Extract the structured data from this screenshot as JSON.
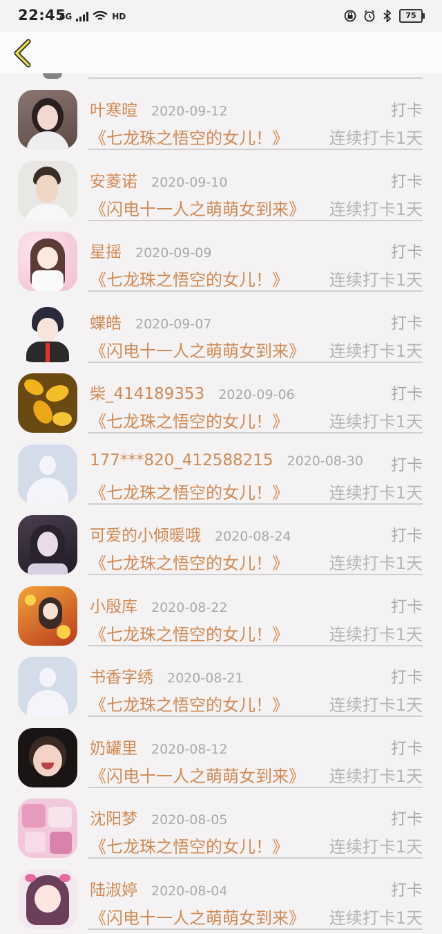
{
  "status_bar": {
    "time": "22:45",
    "network": "4G",
    "hd": "HD",
    "battery": "75"
  },
  "header": {
    "back_icon": "chevron-left-icon"
  },
  "colors": {
    "accent": "#d08a55",
    "muted": "#a9a9a9",
    "divider": "#cfcfcf"
  },
  "items": [
    {
      "name": "叶寒暄",
      "date": "2020-09-12",
      "tag": "打卡",
      "book": "《七龙珠之悟空的女儿！》",
      "streak": "连续打卡1天",
      "avatar": "avatar-girl-photo"
    },
    {
      "name": "安菱诺",
      "date": "2020-09-10",
      "tag": "打卡",
      "book": "《闪电十一人之萌萌女到来》",
      "streak": "连续打卡1天",
      "avatar": "avatar-boy-photo"
    },
    {
      "name": "星摇",
      "date": "2020-09-09",
      "tag": "打卡",
      "book": "《七龙珠之悟空的女儿！》",
      "streak": "连续打卡1天",
      "avatar": "avatar-anime-girl"
    },
    {
      "name": "蝶皓",
      "date": "2020-09-07",
      "tag": "打卡",
      "book": "《闪电十一人之萌萌女到来》",
      "streak": "连续打卡1天",
      "avatar": "avatar-anime-boy"
    },
    {
      "name": "柴_414189353",
      "date": "2020-09-06",
      "tag": "打卡",
      "book": "《七龙珠之悟空的女儿！》",
      "streak": "连续打卡1天",
      "avatar": "avatar-yellow-flowers"
    },
    {
      "name": "177***820_412588215",
      "date": "2020-08-30",
      "tag": "打卡",
      "book": "《七龙珠之悟空的女儿！》",
      "streak": "连续打卡1天",
      "avatar": "avatar-placeholder"
    },
    {
      "name": "可爱的小倾暖哦",
      "date": "2020-08-24",
      "tag": "打卡",
      "book": "《七龙珠之悟空的女儿！》",
      "streak": "连续打卡1天",
      "avatar": "avatar-girl-dark"
    },
    {
      "name": "小殷库",
      "date": "2020-08-22",
      "tag": "打卡",
      "book": "《七龙珠之悟空的女儿！》",
      "streak": "连续打卡1天",
      "avatar": "avatar-anime-autumn"
    },
    {
      "name": "书香字绣",
      "date": "2020-08-21",
      "tag": "打卡",
      "book": "《七龙珠之悟空的女儿！》",
      "streak": "连续打卡1天",
      "avatar": "avatar-placeholder"
    },
    {
      "name": "奶罐里",
      "date": "2020-08-12",
      "tag": "打卡",
      "book": "《闪电十一人之萌萌女到来》",
      "streak": "连续打卡1天",
      "avatar": "avatar-child-photo"
    },
    {
      "name": "沈阳梦",
      "date": "2020-08-05",
      "tag": "打卡",
      "book": "《七龙珠之悟空的女儿！》",
      "streak": "连续打卡1天",
      "avatar": "avatar-pink-collage"
    },
    {
      "name": "陆淑婷",
      "date": "2020-08-04",
      "tag": "打卡",
      "book": "《闪电十一人之萌萌女到来》",
      "streak": "连续打卡1天",
      "avatar": "avatar-anime-pink-girl"
    }
  ]
}
